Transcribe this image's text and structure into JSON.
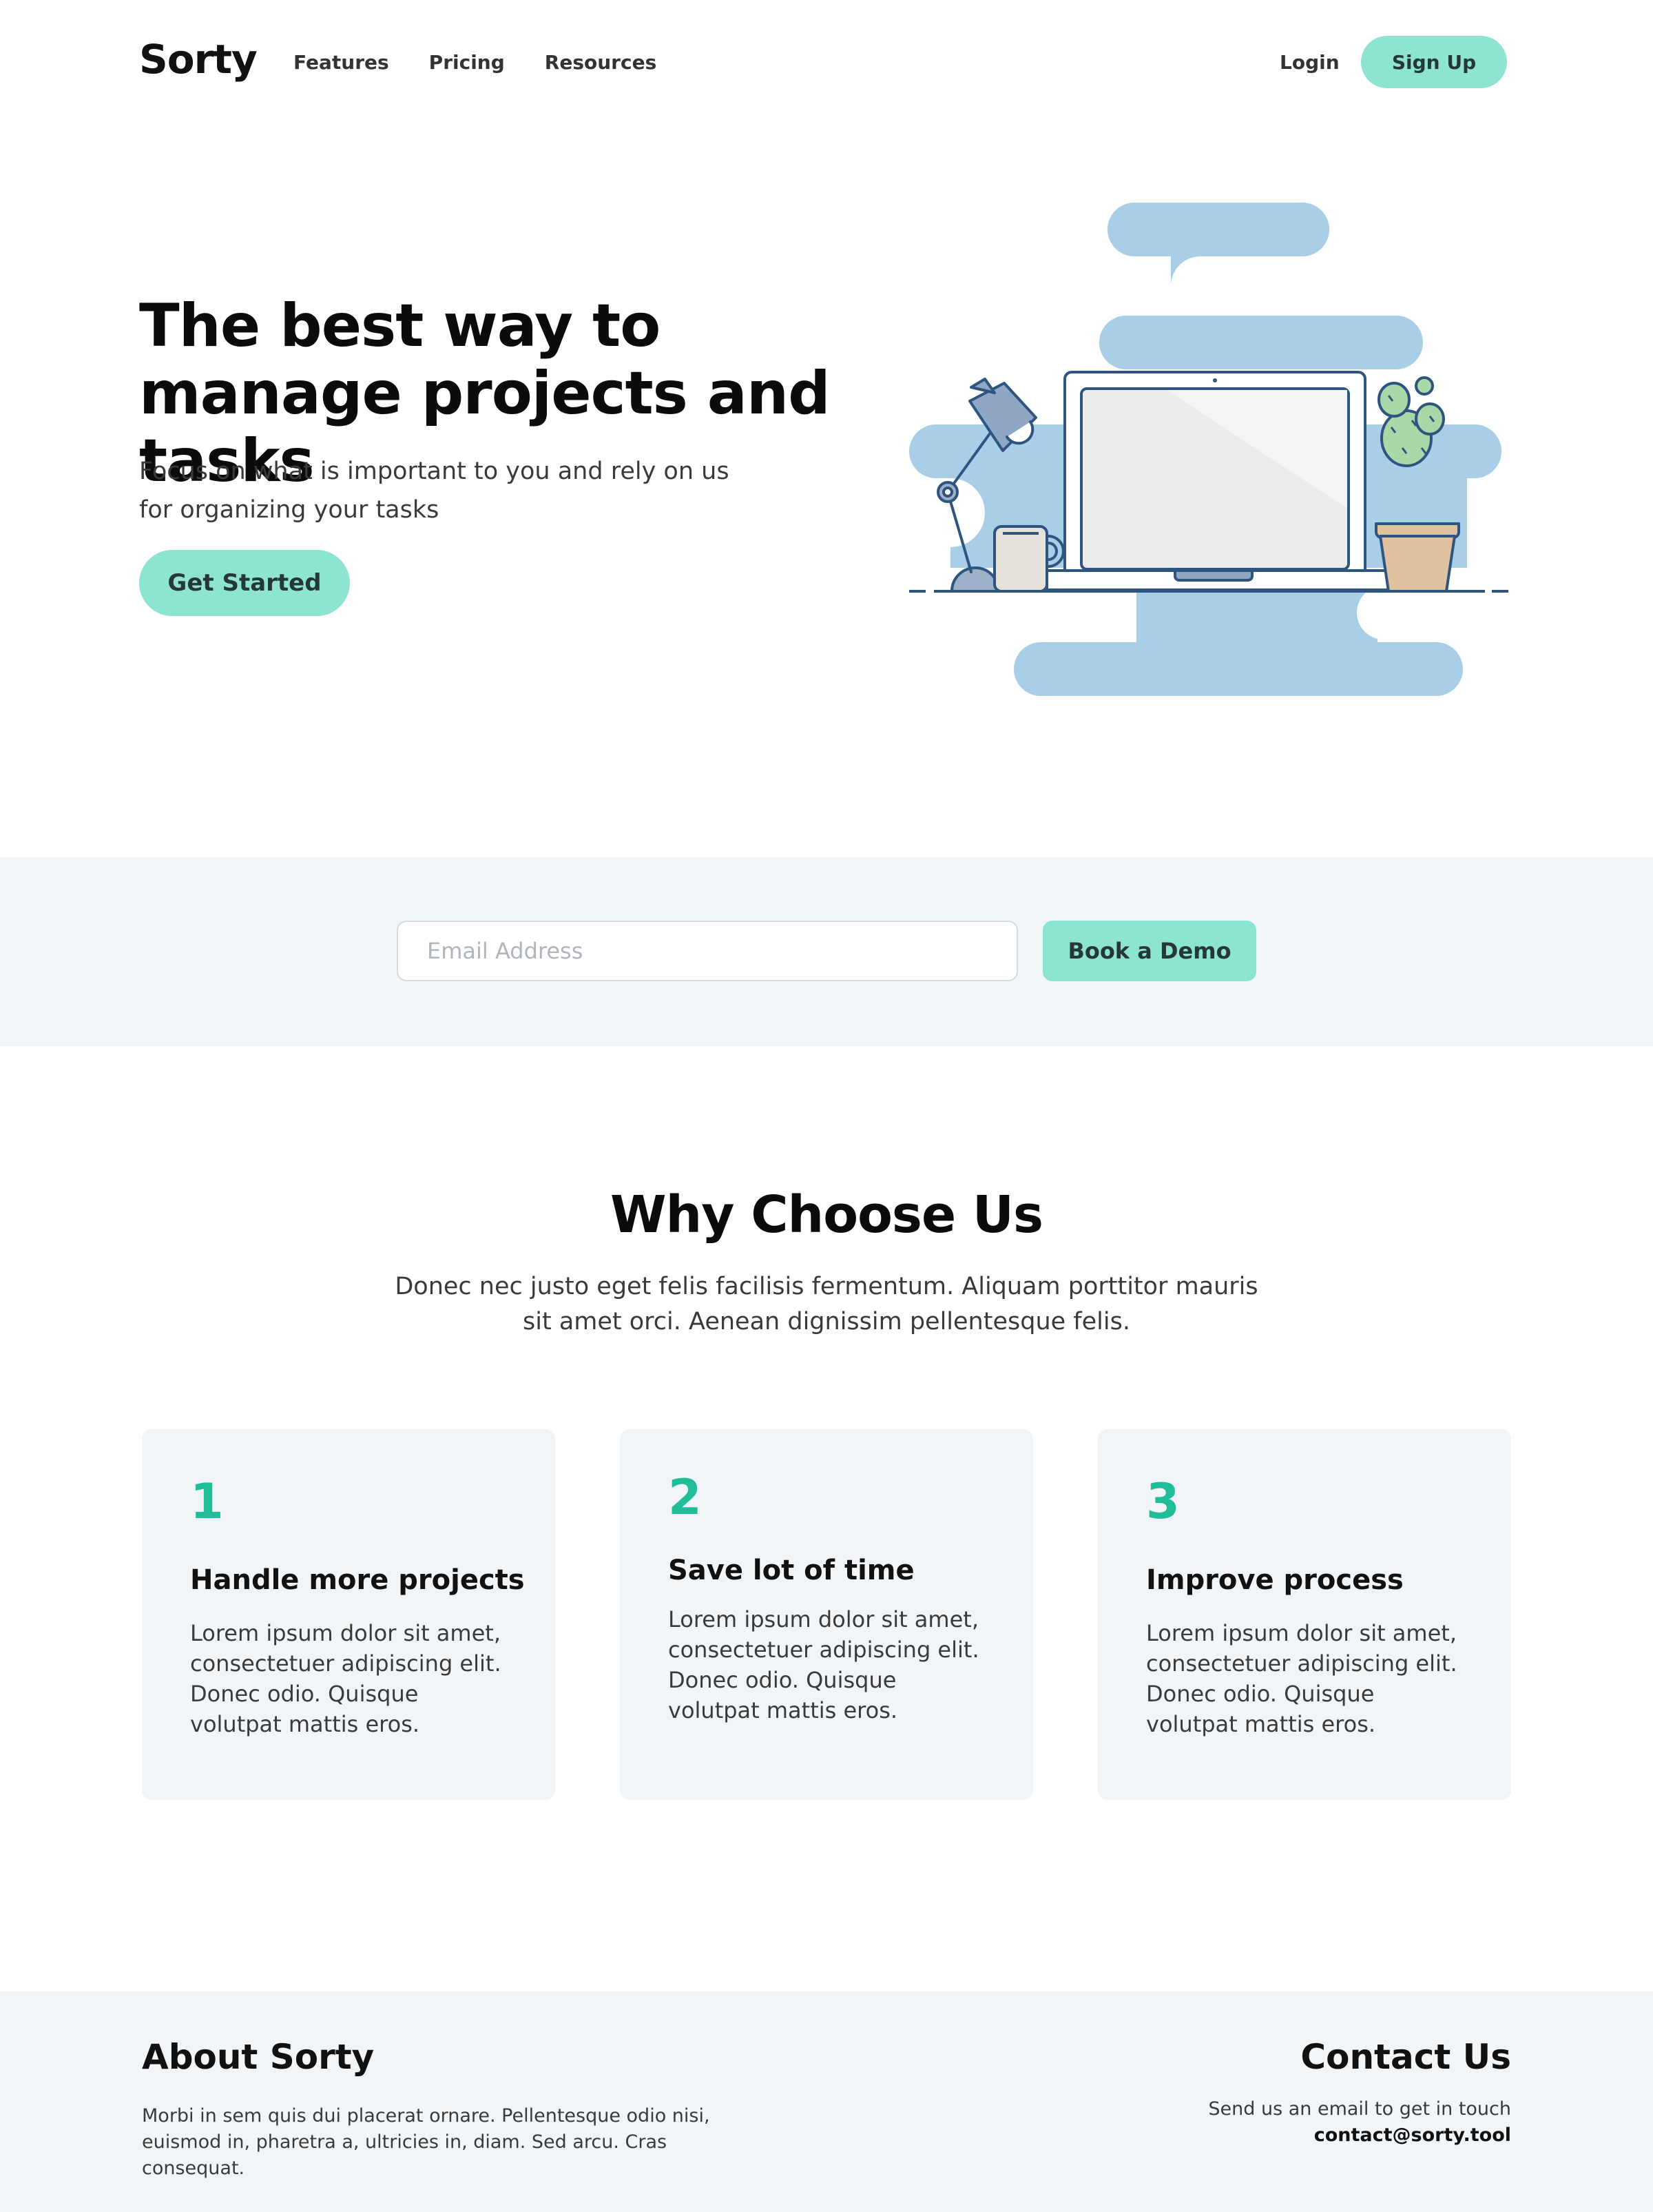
{
  "nav": {
    "logo": "Sorty",
    "links": [
      "Features",
      "Pricing",
      "Resources"
    ],
    "login": "Login",
    "signup": "Sign Up"
  },
  "hero": {
    "title": "The best way to manage projects and tasks",
    "subtitle": "Focus on what is important to you and rely on us for organizing your tasks",
    "cta": "Get Started"
  },
  "demo": {
    "email_placeholder": "Email Address",
    "email_value": "",
    "button": "Book a Demo"
  },
  "why": {
    "title": "Why Choose Us",
    "subtitle": "Donec nec justo eget felis facilisis fermentum. Aliquam porttitor mauris sit amet orci. Aenean dignissim pellentesque felis.",
    "cards": [
      {
        "number": "1",
        "title": "Handle more projects",
        "text": "Lorem ipsum dolor sit amet, consectetuer adipiscing elit. Donec odio. Quisque volutpat mattis eros."
      },
      {
        "number": "2",
        "title": "Save lot of time",
        "text": "Lorem ipsum dolor sit amet, consectetuer adipiscing elit. Donec odio. Quisque volutpat mattis eros."
      },
      {
        "number": "3",
        "title": "Improve process",
        "text": "Lorem ipsum dolor sit amet, consectetuer adipiscing elit. Donec odio. Quisque volutpat mattis eros."
      }
    ]
  },
  "footer": {
    "about_title": "About Sorty",
    "about_text": "Morbi in sem quis dui placerat ornare. Pellentesque odio nisi, euismod in, pharetra a, ultricies in, diam. Sed arcu. Cras consequat.",
    "contact_title": "Contact Us",
    "contact_text": "Send us an email to get in touch",
    "contact_email": "contact@sorty.tool"
  },
  "colors": {
    "accent": "#8de4d1",
    "number_green": "#20bd99",
    "illustration_blue": "#a9cee8",
    "panel_bg": "#f1f5f8"
  },
  "illustration": {
    "name": "desk-illustration",
    "objects": [
      "lamp-icon",
      "mug-icon",
      "laptop-icon",
      "cactus-icon"
    ]
  }
}
